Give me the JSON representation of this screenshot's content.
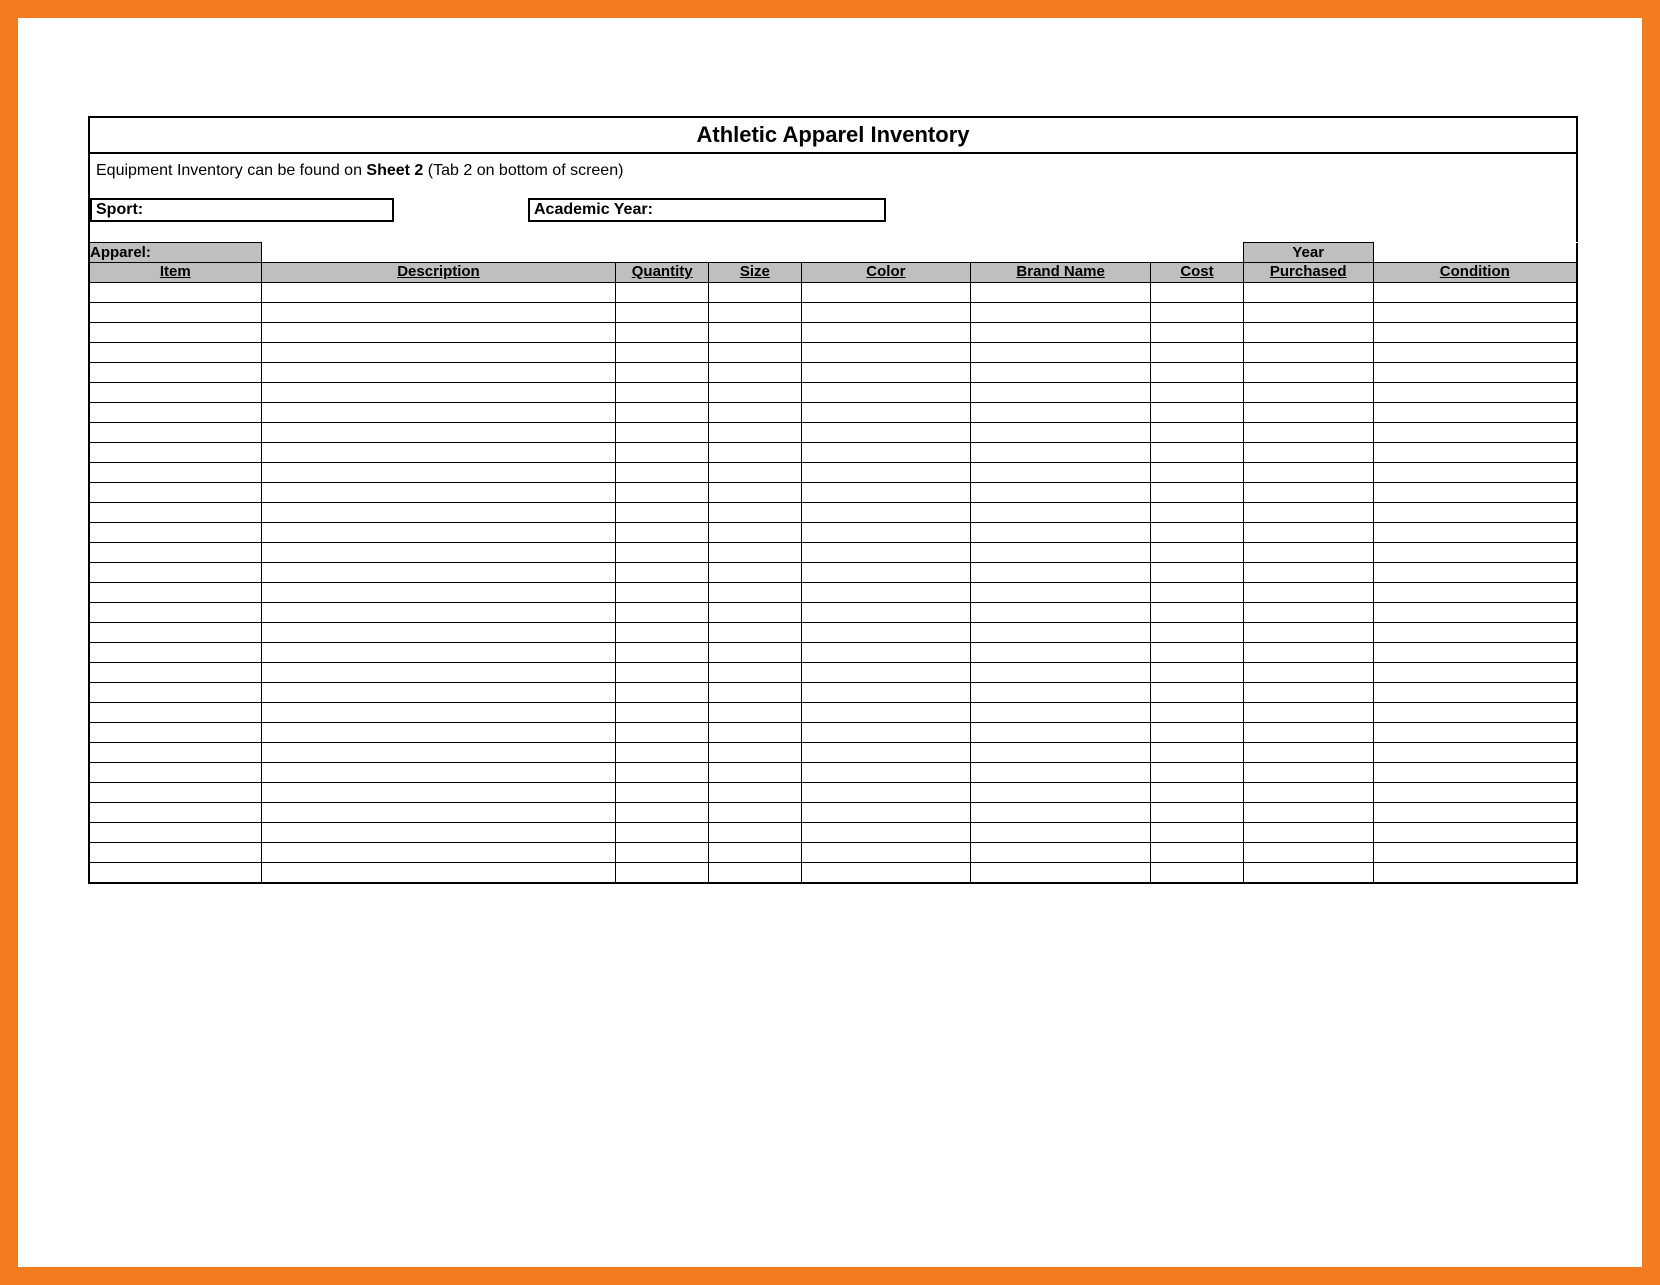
{
  "title": "Athletic Apparel Inventory",
  "note_prefix": "Equipment Inventory can be found on ",
  "note_bold": "Sheet 2",
  "note_suffix": " (Tab 2 on bottom of screen)",
  "fields": {
    "sport_label": "Sport:",
    "sport_value": "",
    "year_label": "Academic Year:",
    "year_value": ""
  },
  "section_label": "Apparel:",
  "columns": {
    "item": "Item",
    "description": "Description",
    "quantity": "Quantity",
    "size": "Size",
    "color": "Color",
    "brand": "Brand Name",
    "cost": "Cost",
    "year_purchased_line1": "Year",
    "year_purchased_line2": "Purchased",
    "condition": "Condition"
  },
  "row_count": 30,
  "colors": {
    "border_accent": "#f47c20",
    "header_fill": "#bfbfbf"
  }
}
